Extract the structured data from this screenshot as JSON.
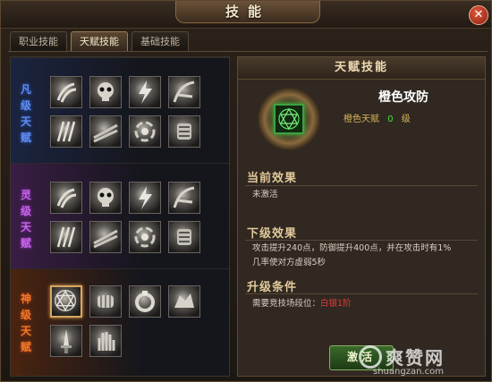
{
  "window": {
    "title": "技能",
    "close_symbol": "✕"
  },
  "tabs": [
    {
      "label": "职业技能",
      "active": false
    },
    {
      "label": "天赋技能",
      "active": true
    },
    {
      "label": "基础技能",
      "active": false
    }
  ],
  "tiers": [
    {
      "label_chars": [
        "凡",
        "级",
        "天",
        "赋"
      ],
      "color": "#4a7ae0",
      "skills": [
        "claw-icon",
        "skull-icon",
        "lightning-icon",
        "talon-icon",
        "blade-claw-icon",
        "slash-icon",
        "vortex-icon",
        "gauntlet-icon"
      ]
    },
    {
      "label_chars": [
        "灵",
        "级",
        "天",
        "赋"
      ],
      "color": "#b048d0",
      "skills": [
        "claw-icon",
        "skull-icon",
        "lightning-icon",
        "talon-icon",
        "blade-claw-icon",
        "slash-icon",
        "vortex-icon",
        "gauntlet-icon"
      ]
    },
    {
      "label_chars": [
        "神",
        "级",
        "天",
        "赋"
      ],
      "color": "#e06a20",
      "skills": [
        "hexagram-icon",
        "fist-icon",
        "ring-icon",
        "beast-icon",
        "dagger-icon",
        "palm-icon"
      ]
    }
  ],
  "detail": {
    "header": "天赋技能",
    "skill_name": "橙色攻防",
    "level_label": "橙色天赋",
    "level_value": "0",
    "level_unit": "级",
    "current_effect_title": "当前效果",
    "current_effect": "未激活",
    "next_effect_title": "下级效果",
    "next_effect_line1": "攻击提升240点，防御提升400点，并在攻击时有1%",
    "next_effect_line2": "几率使对方虚弱5秒",
    "upgrade_title": "升级条件",
    "upgrade_label": "需要竞技场段位：",
    "upgrade_value": "白银1阶",
    "activate_button": "激活"
  },
  "watermark": {
    "big": "爽赞网",
    "small": "shuangzan.com"
  },
  "colors": {
    "accent_gold": "#d8a560",
    "tier_common": "#4a7ae0",
    "tier_spirit": "#b048d0",
    "tier_divine": "#e06a20"
  }
}
